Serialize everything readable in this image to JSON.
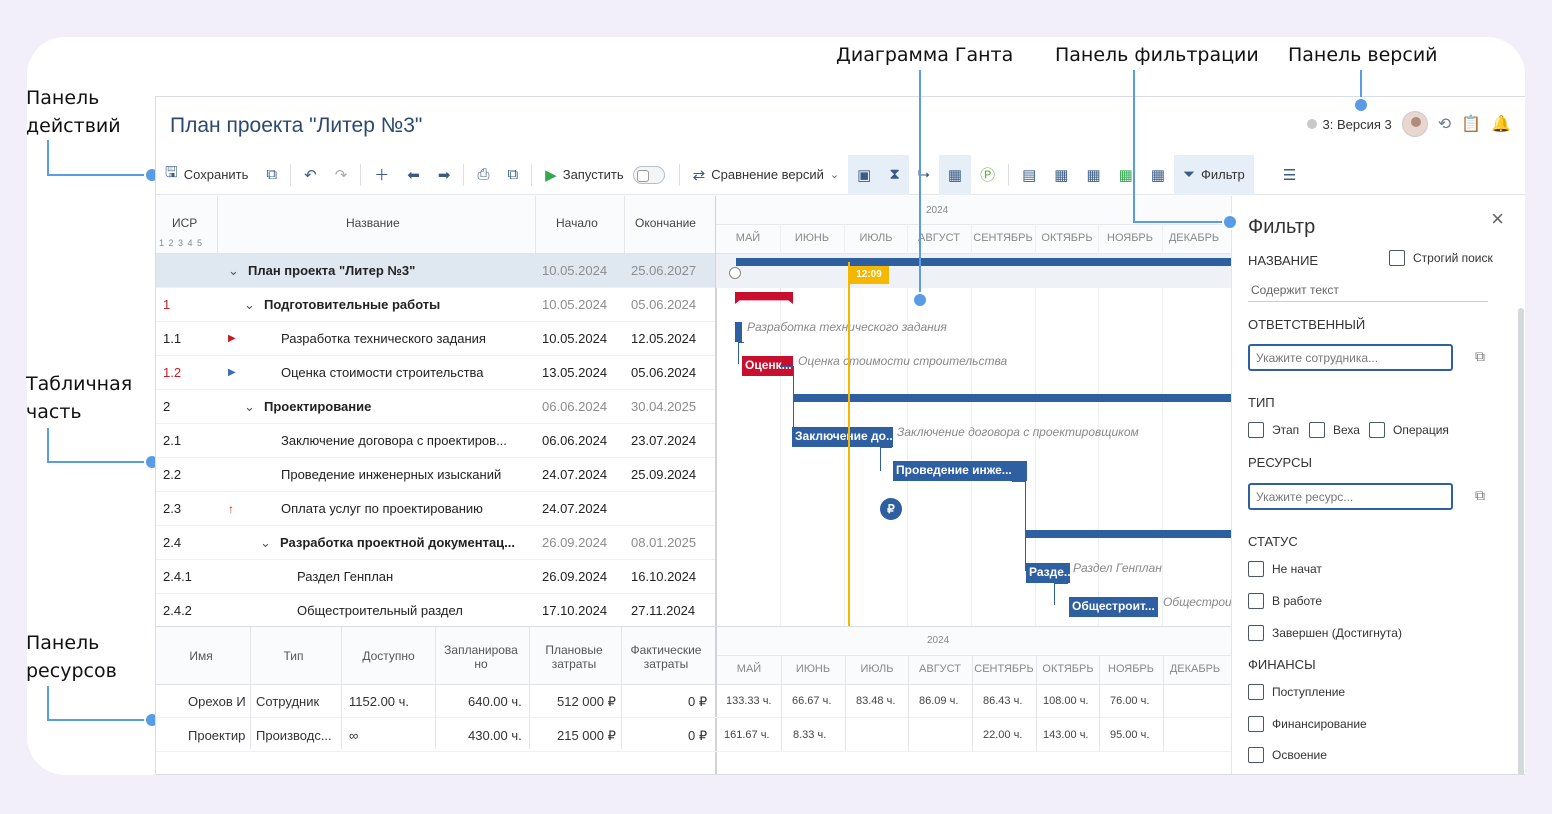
{
  "callouts": {
    "actions": "Панель\nдействий",
    "table": "Табличная\nчасть",
    "resources": "Панель\nресурсов",
    "gantt": "Диаграмма Ганта",
    "filter": "Панель фильтрации",
    "versions": "Панель версий"
  },
  "header": {
    "title": "План проекта \"Литер №3\"",
    "version": "3: Версия 3"
  },
  "toolbar": {
    "save": "Сохранить",
    "run": "Запустить",
    "compare": "Сравнение версий",
    "filter": "Фильтр"
  },
  "grid": {
    "col_wbs": "ИСР",
    "wbs_levels": "1 2 3 4 5",
    "col_name": "Название",
    "col_start": "Начало",
    "col_end": "Окончание",
    "rows": [
      {
        "wbs": "",
        "name": "План проекта \"Литер №3\"",
        "start": "10.05.2024",
        "end": "25.06.2027"
      },
      {
        "wbs": "1",
        "name": "Подготовительные работы",
        "start": "10.05.2024",
        "end": "05.06.2024"
      },
      {
        "wbs": "1.1",
        "name": "Разработка технического задания",
        "start": "10.05.2024",
        "end": "12.05.2024"
      },
      {
        "wbs": "1.2",
        "name": "Оценка стоимости строительства",
        "start": "13.05.2024",
        "end": "05.06.2024"
      },
      {
        "wbs": "2",
        "name": "Проектирование",
        "start": "06.06.2024",
        "end": "30.04.2025"
      },
      {
        "wbs": "2.1",
        "name": "Заключение договора с проектиров...",
        "start": "06.06.2024",
        "end": "23.07.2024"
      },
      {
        "wbs": "2.2",
        "name": "Проведение инженерных изысканий",
        "start": "24.07.2024",
        "end": "25.09.2024"
      },
      {
        "wbs": "2.3",
        "name": "Оплата услуг по проектированию",
        "start": "24.07.2024",
        "end": ""
      },
      {
        "wbs": "2.4",
        "name": "Разработка проектной документац...",
        "start": "26.09.2024",
        "end": "08.01.2025"
      },
      {
        "wbs": "2.4.1",
        "name": "Раздел Генплан",
        "start": "26.09.2024",
        "end": "16.10.2024"
      },
      {
        "wbs": "2.4.2",
        "name": "Общестроительный раздел",
        "start": "17.10.2024",
        "end": "27.11.2024"
      }
    ]
  },
  "gantt": {
    "year": "2024",
    "months": [
      "МАЙ",
      "ИЮНЬ",
      "ИЮЛЬ",
      "АВГУСТ",
      "СЕНТЯБРЬ",
      "ОКТЯБРЬ",
      "НОЯБРЬ",
      "ДЕКАБРЬ"
    ],
    "today": "12:09",
    "bars": {
      "b12": "Оценк...",
      "b21": "Заключение до...",
      "b22": "Проведение инже...",
      "b241": "Разде...",
      "b242": "Общестроит..."
    },
    "labels": {
      "l11": "Разработка технического задания",
      "l12": "Оценка стоимости строительства",
      "l21": "Заключение договора с проектировщиком",
      "l241": "Раздел Генплан",
      "l242": "Общестрои"
    }
  },
  "filter": {
    "title": "Фильтр",
    "name_label": "НАЗВАНИЕ",
    "strict": "Строгий поиск",
    "name_ph": "Содержит текст",
    "resp_label": "ОТВЕТСТВЕННЫЙ",
    "resp_ph": "Укажите сотрудника...",
    "type_label": "ТИП",
    "types": [
      "Этап",
      "Веха",
      "Операция"
    ],
    "res_label": "РЕСУРСЫ",
    "res_ph": "Укажите ресурс...",
    "status_label": "СТАТУС",
    "statuses": [
      "Не начат",
      "В работе",
      "Завершен (Достигнута)"
    ],
    "fin_label": "ФИНАНСЫ",
    "fins": [
      "Поступление",
      "Финансирование",
      "Освоение"
    ]
  },
  "resources": {
    "headers": [
      "Имя",
      "Тип",
      "Доступно",
      "Запланирова но",
      "Плановые затраты",
      "Фактические затраты"
    ],
    "rows": [
      {
        "name": "Орехов И",
        "type": "Сотрудник",
        "avail": "1152.00 ч.",
        "plan": "640.00 ч.",
        "pcost": "512 000 ₽",
        "fcost": "0 ₽",
        "m": [
          "133.33 ч.",
          "66.67 ч.",
          "83.48 ч.",
          "86.09 ч.",
          "86.43 ч.",
          "108.00 ч.",
          "76.00 ч.",
          ""
        ]
      },
      {
        "name": "Проектир",
        "type": "Производс...",
        "avail": "∞",
        "plan": "430.00 ч.",
        "pcost": "215 000 ₽",
        "fcost": "0 ₽",
        "m": [
          "161.67 ч.",
          "8.33 ч.",
          "",
          "",
          "22.00 ч.",
          "143.00 ч.",
          "95.00 ч.",
          ""
        ]
      }
    ]
  }
}
